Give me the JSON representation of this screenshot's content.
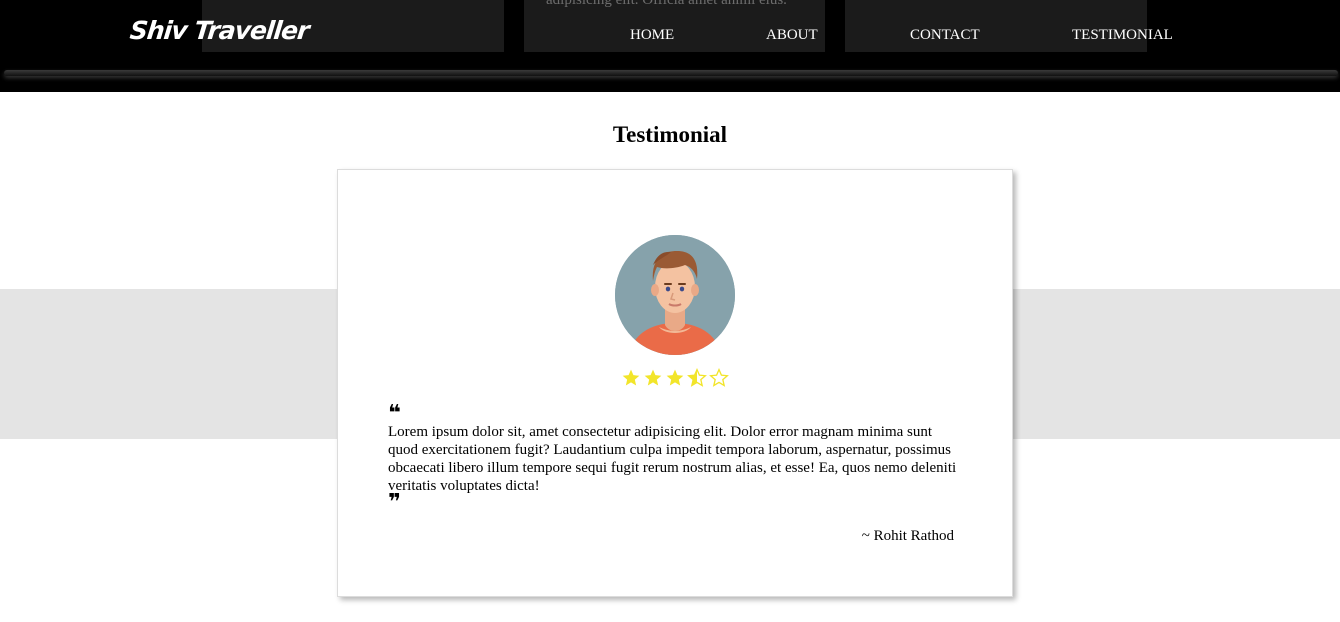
{
  "header": {
    "logo": "Shiv Traveller",
    "ghost_text": "adipisicing elit. Officia amet animi eius.",
    "nav": [
      {
        "label": "HOME"
      },
      {
        "label": "ABOUT"
      },
      {
        "label": "CONTACT"
      },
      {
        "label": "TESTIMONIAL"
      }
    ]
  },
  "section": {
    "title": "Testimonial"
  },
  "testimonial": {
    "rating": 3.5,
    "rating_max": 5,
    "quote": "Lorem ipsum dolor sit, amet consectetur adipisicing elit. Dolor error magnam minima sunt quod exercitationem fugit? Laudantium culpa impedit tempora laborum, aspernatur, possimus obcaecati libero illum tempore sequi fugit rerum nostrum alias, et esse! Ea, quos nemo deleniti veritatis voluptates dicta!",
    "author": "~ Rohit Rathod",
    "quote_open": "❝",
    "quote_close": "❞"
  },
  "colors": {
    "header_bg": "#000000",
    "band_bg": "#e4e4e4",
    "star_color": "#f2e52a",
    "avatar_bg": "#86a2ab",
    "shirt": "#ea6b48"
  }
}
